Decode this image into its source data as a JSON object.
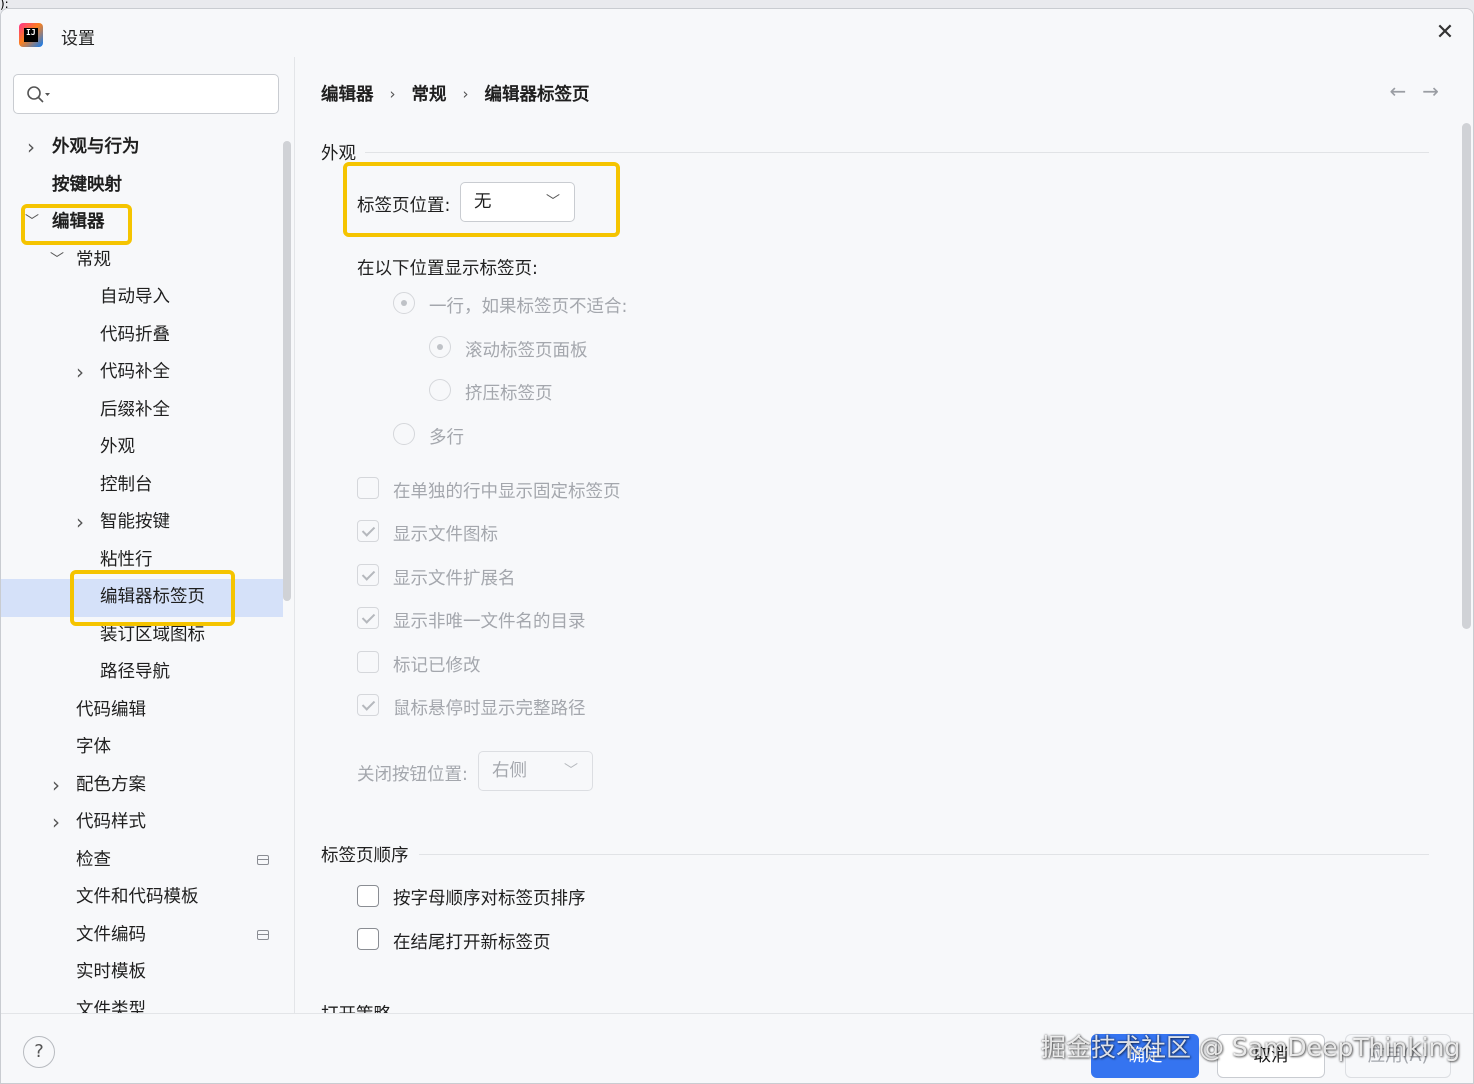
{
  "window": {
    "title": "设置"
  },
  "search": {
    "placeholder": ""
  },
  "sidebar": {
    "items": [
      {
        "label": "外观与行为",
        "bold": true,
        "chevron": "right",
        "indent": 0
      },
      {
        "label": "按键映射",
        "bold": true,
        "chevron": "",
        "indent": 0
      },
      {
        "label": "编辑器",
        "bold": true,
        "chevron": "down",
        "indent": 0
      },
      {
        "label": "常规",
        "bold": false,
        "chevron": "down",
        "indent": 1
      },
      {
        "label": "自动导入",
        "bold": false,
        "chevron": "",
        "indent": 2
      },
      {
        "label": "代码折叠",
        "bold": false,
        "chevron": "",
        "indent": 2
      },
      {
        "label": "代码补全",
        "bold": false,
        "chevron": "right",
        "indent": 2
      },
      {
        "label": "后缀补全",
        "bold": false,
        "chevron": "",
        "indent": 2
      },
      {
        "label": "外观",
        "bold": false,
        "chevron": "",
        "indent": 2
      },
      {
        "label": "控制台",
        "bold": false,
        "chevron": "",
        "indent": 2
      },
      {
        "label": "智能按键",
        "bold": false,
        "chevron": "right",
        "indent": 2
      },
      {
        "label": "粘性行",
        "bold": false,
        "chevron": "",
        "indent": 2
      },
      {
        "label": "编辑器标签页",
        "bold": false,
        "chevron": "",
        "indent": 2,
        "selected": true
      },
      {
        "label": "装订区域图标",
        "bold": false,
        "chevron": "",
        "indent": 2
      },
      {
        "label": "路径导航",
        "bold": false,
        "chevron": "",
        "indent": 2
      },
      {
        "label": "代码编辑",
        "bold": false,
        "chevron": "",
        "indent": 1
      },
      {
        "label": "字体",
        "bold": false,
        "chevron": "",
        "indent": 1
      },
      {
        "label": "配色方案",
        "bold": false,
        "chevron": "right",
        "indent": 1
      },
      {
        "label": "代码样式",
        "bold": false,
        "chevron": "right",
        "indent": 1
      },
      {
        "label": "检查",
        "bold": false,
        "chevron": "",
        "indent": 1,
        "side_icon": true
      },
      {
        "label": "文件和代码模板",
        "bold": false,
        "chevron": "",
        "indent": 1
      },
      {
        "label": "文件编码",
        "bold": false,
        "chevron": "",
        "indent": 1,
        "side_icon": true
      },
      {
        "label": "实时模板",
        "bold": false,
        "chevron": "",
        "indent": 1
      },
      {
        "label": "文件类型",
        "bold": false,
        "chevron": "",
        "indent": 1
      }
    ]
  },
  "breadcrumb": {
    "items": [
      "编辑器",
      "常规",
      "编辑器标签页"
    ],
    "separator": "›"
  },
  "nav": {
    "back": "←",
    "forward": "→"
  },
  "appearance": {
    "title": "外观",
    "tab_position_label": "标签页位置:",
    "tab_position_value": "无",
    "show_tabs_in_label": "在以下位置显示标签页:",
    "radio_one_row": "一行，如果标签页不适合:",
    "radio_scroll": "滚动标签页面板",
    "radio_squeeze": "挤压标签页",
    "radio_multi": "多行",
    "checkboxes": [
      {
        "label": "在单独的行中显示固定标签页",
        "checked": false
      },
      {
        "label": "显示文件图标",
        "checked": true
      },
      {
        "label": "显示文件扩展名",
        "checked": true
      },
      {
        "label": "显示非唯一文件名的目录",
        "checked": true
      },
      {
        "label": "标记已修改",
        "checked": false
      },
      {
        "label": "鼠标悬停时显示完整路径",
        "checked": true
      }
    ],
    "close_button_label": "关闭按钮位置:",
    "close_button_value": "右侧"
  },
  "tab_order": {
    "title": "标签页顺序",
    "sort_alpha": "按字母顺序对标签页排序",
    "open_at_end": "在结尾打开新标签页"
  },
  "open_policy": {
    "title": "打开策略"
  },
  "footer": {
    "help": "?",
    "ok": "确定",
    "cancel": "取消",
    "apply": "应用(A)",
    "watermark": "掘金技术社区 @ SamDeepThinking"
  },
  "colors": {
    "accent": "#3574f0",
    "highlight": "#f5c400",
    "selected_row": "#d5e1f9"
  }
}
